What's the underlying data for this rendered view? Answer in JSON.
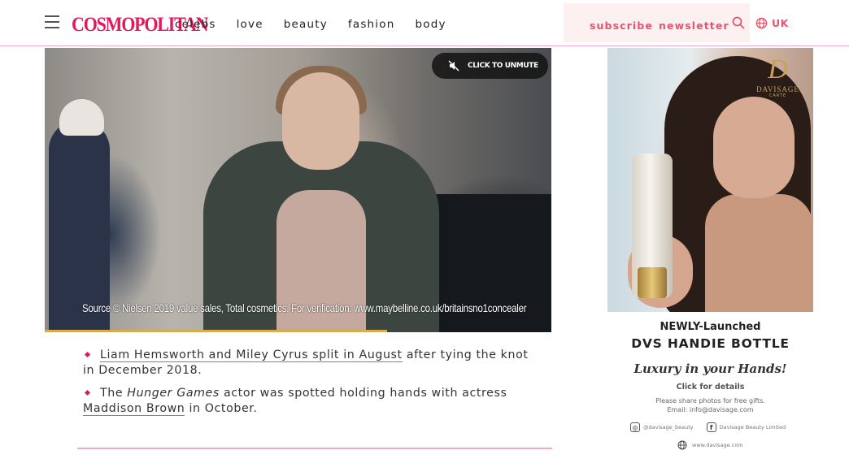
{
  "header": {
    "logo": "COSMOPOLITAN",
    "nav": [
      "celebs",
      "love",
      "beauty",
      "fashion",
      "body"
    ],
    "subscribe": "subscribe",
    "newsletter": "newsletter",
    "region": "UK",
    "accent_color": "#e2185b"
  },
  "video": {
    "unmute_label": "CLICK TO UNMUTE",
    "caption": "Source © Nielsen 2019 value sales, Total cosmetics. For verification: www.maybelline.co.uk/britainsno1concealer",
    "progress_fraction": 0.675,
    "progress_color": "#d7ac4e"
  },
  "article": {
    "bullet1": {
      "link": "Liam Hemsworth and Miley Cyrus split in August",
      "text": " after tying the knot in December 2018."
    },
    "bullet2": {
      "prefix": "The ",
      "italic": "Hunger Games",
      "middle": " actor was spotted holding hands with actress ",
      "link": "Maddison Brown",
      "suffix": " in October."
    }
  },
  "ad": {
    "logo_mark": "D",
    "logo_brand": "DAVISAGE",
    "logo_sub": "CARTE",
    "headline1": "NEWLY-Launched",
    "headline2": "DVS HANDIE BOTTLE",
    "tagline": "Luxury in your Hands!",
    "cta": "Click for details",
    "note": "Please share photos for free gifts.",
    "email": "Email: info@davisage.com",
    "instagram": "@davisage_beauty",
    "facebook": "Davisage Beauty Limited",
    "website": "www.davisage.com"
  }
}
